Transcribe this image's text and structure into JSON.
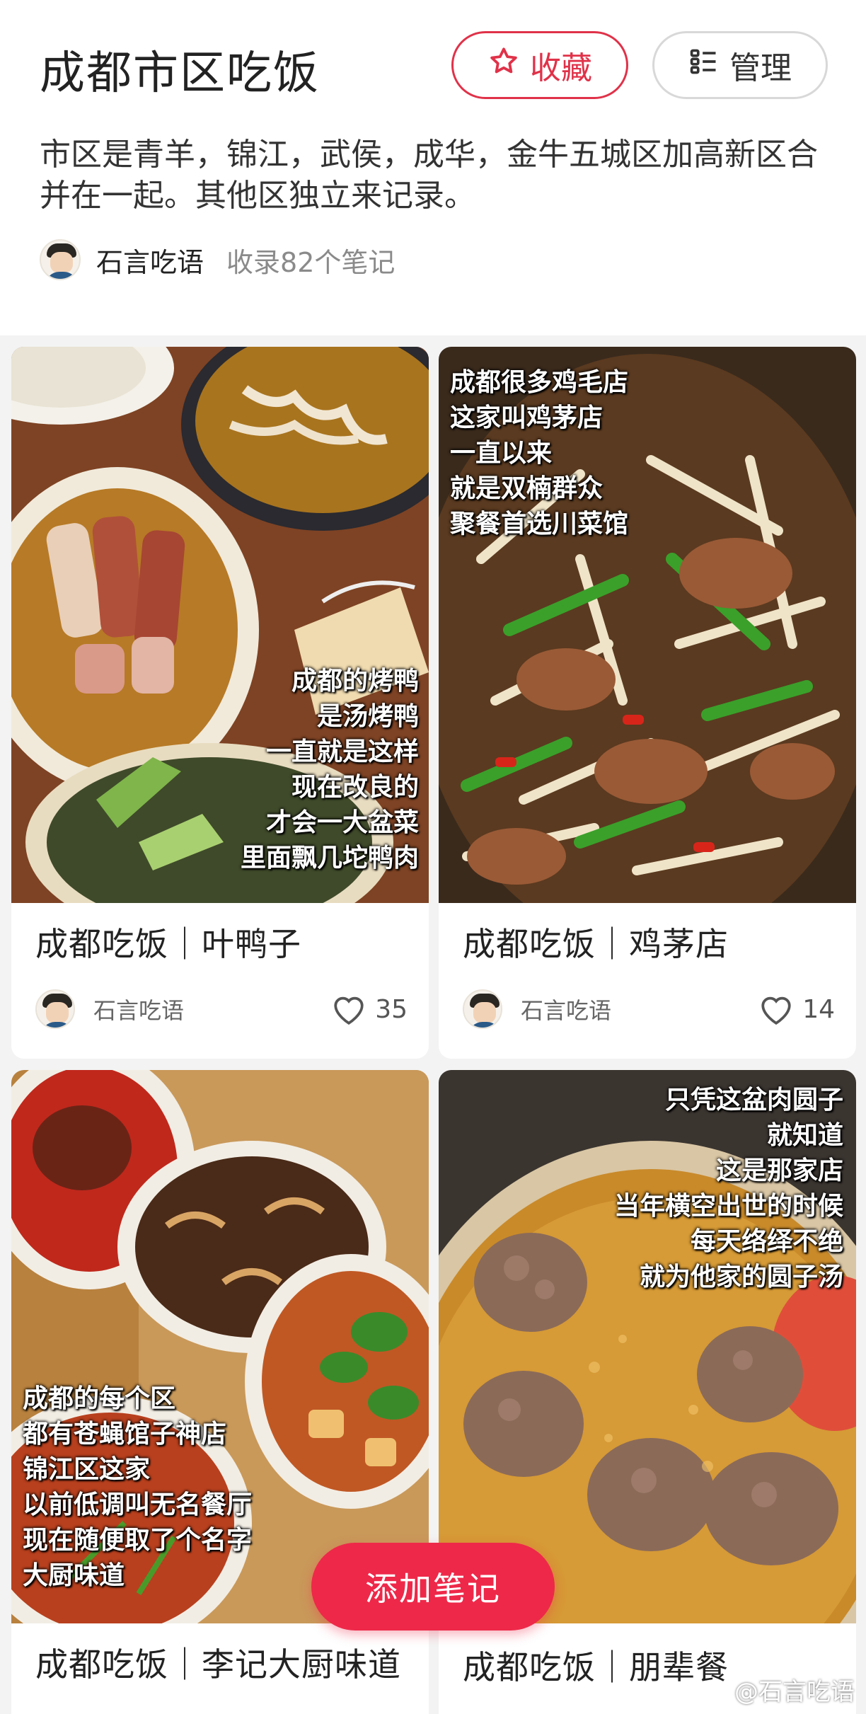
{
  "header": {
    "title": "成都市区吃饭",
    "favorite_label": "收藏",
    "manage_label": "管理",
    "description": "市区是青羊，锦江，武侯，成华，金牛五城区加高新区合并在一起。其他区独立来记录。",
    "author_name": "石言吃语",
    "note_count": "收录82个笔记"
  },
  "colors": {
    "accent": "#e03249",
    "fab": "#ee2849"
  },
  "cards": [
    {
      "title": "成都吃饭｜叶鸭子",
      "author": "石言吃语",
      "likes": "35",
      "overlay": [
        "成都的烤鸭",
        "是汤烤鸭",
        "一直就是这样",
        "现在改良的",
        "才会一大盆菜",
        "里面飘几坨鸭肉"
      ]
    },
    {
      "title": "成都吃饭｜鸡茅店",
      "author": "石言吃语",
      "likes": "14",
      "overlay": [
        "成都很多鸡毛店",
        "这家叫鸡茅店",
        "一直以来",
        "就是双楠群众",
        "聚餐首选川菜馆"
      ]
    },
    {
      "title": "成都吃饭｜李记大厨味道",
      "overlay": [
        "成都的每个区",
        "都有苍蝇馆子神店",
        "锦江区这家",
        "以前低调叫无名餐厅",
        "现在随便取了个名字",
        "大厨味道"
      ]
    },
    {
      "title": "成都吃饭｜朋辈餐",
      "overlay": [
        "只凭这盆肉圆子",
        "就知道",
        "这是那家店",
        "当年横空出世的时候",
        "每天络绎不绝",
        "就为他家的圆子汤"
      ]
    }
  ],
  "fab_label": "添加笔记",
  "watermark": "@石言吃语"
}
